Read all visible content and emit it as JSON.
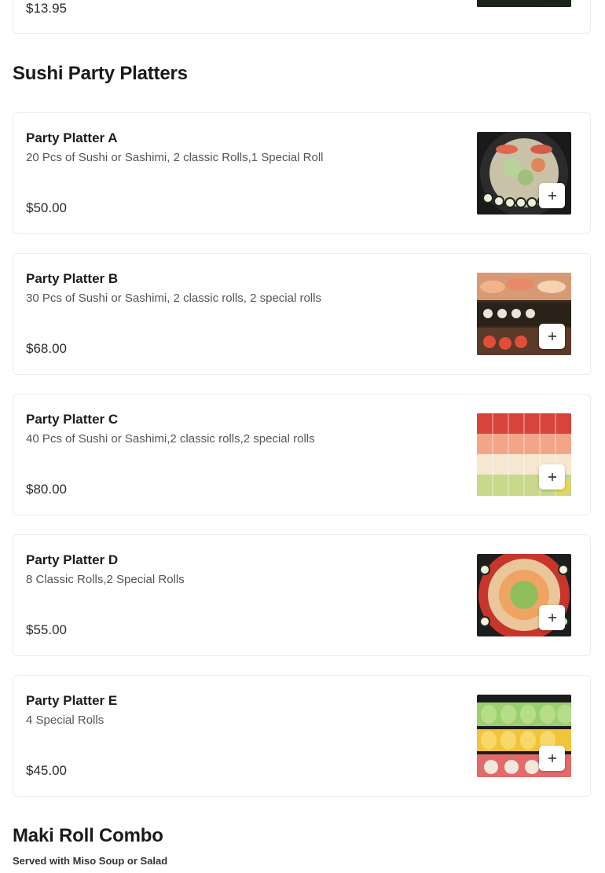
{
  "previous_item": {
    "price": "$13.95"
  },
  "sections": [
    {
      "title": "Sushi Party Platters",
      "items": [
        {
          "name": "Party Platter A",
          "description": "20 Pcs of Sushi or Sashimi, 2 classic Rolls,1 Special Roll",
          "price": "$50.00"
        },
        {
          "name": "Party Platter B",
          "description": "30 Pcs of Sushi or Sashimi, 2 classic rolls, 2 special rolls",
          "price": "$68.00"
        },
        {
          "name": "Party Platter C",
          "description": "40 Pcs of Sushi or Sashimi,2 classic rolls,2 special rolls",
          "price": "$80.00"
        },
        {
          "name": "Party Platter D",
          "description": "8 Classic Rolls,2 Special Rolls",
          "price": "$55.00"
        },
        {
          "name": "Party Platter E",
          "description": "4 Special Rolls",
          "price": "$45.00"
        }
      ]
    },
    {
      "title": "Maki Roll Combo",
      "subtitle": "Served with Miso Soup or Salad"
    }
  ],
  "icons": {
    "add": "plus-icon"
  }
}
